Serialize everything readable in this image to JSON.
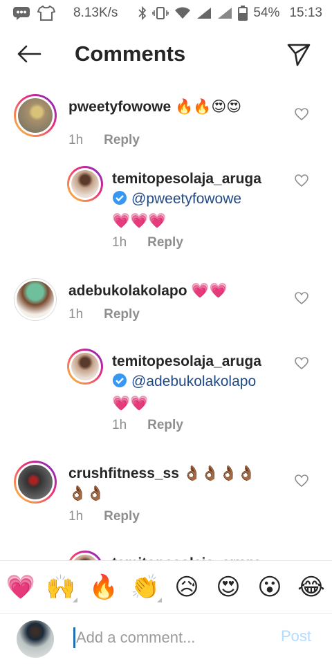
{
  "status_bar": {
    "speed": "8.13K/s",
    "battery": "54%",
    "time": "15:13"
  },
  "header": {
    "title": "Comments"
  },
  "comments": [
    {
      "username": "pweetyfowowe",
      "text": "🔥🔥😍😍",
      "time": "1h",
      "reply_label": "Reply"
    },
    {
      "username": "temitopesolaja_aruga",
      "mention": "@pweetyfowowe",
      "text": "💗💗💗",
      "time": "1h",
      "reply_label": "Reply",
      "verified": true
    },
    {
      "username": "adebukolakolapo",
      "text": "💗💗",
      "time": "1h",
      "reply_label": "Reply"
    },
    {
      "username": "temitopesolaja_aruga",
      "mention": "@adebukolakolapo",
      "text": "💗💗",
      "time": "1h",
      "reply_label": "Reply",
      "verified": true
    },
    {
      "username": "crushfitness_ss",
      "text": "👌🏾👌🏾👌🏾👌🏾",
      "text2": "👌🏾👌🏾",
      "time": "1h",
      "reply_label": "Reply"
    },
    {
      "username": "temitopesolaja_aruga"
    }
  ],
  "reactions": [
    "💗",
    "🙌",
    "🔥",
    "👏",
    "😥",
    "😍",
    "😮",
    "😂"
  ],
  "composer": {
    "placeholder": "Add a comment...",
    "post_label": "Post"
  },
  "colors": {
    "mention": "#1f4a87",
    "verified": "#3897f0",
    "post_disabled": "#b3dbff",
    "secondary_text": "#8e8e8e"
  },
  "icons": [
    "back-arrow-icon",
    "send-icon",
    "heart-outline-icon",
    "verified-badge-icon"
  ]
}
